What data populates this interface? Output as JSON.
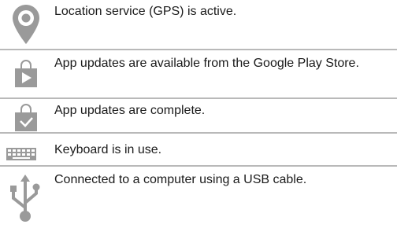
{
  "rows": [
    {
      "icon": "location-pin-icon",
      "text": "Location service (GPS) is active."
    },
    {
      "icon": "play-store-update-icon",
      "text": "App updates are available from the Google Play Store."
    },
    {
      "icon": "play-store-check-icon",
      "text": "App updates are complete."
    },
    {
      "icon": "keyboard-icon",
      "text": "Keyboard is in use."
    },
    {
      "icon": "usb-icon",
      "text": "Connected to a computer using a USB cable."
    }
  ],
  "colors": {
    "icon_gray": "#9a9a9a",
    "rule_gray": "#b9b9b9",
    "text": "#1a1a1a"
  }
}
